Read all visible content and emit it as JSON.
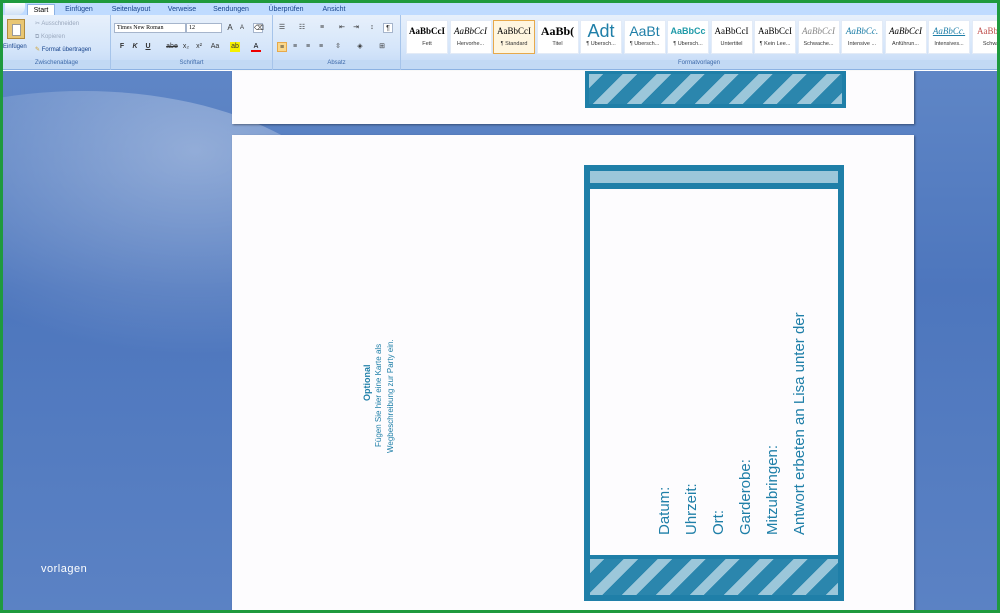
{
  "tabs": [
    "Start",
    "Einfügen",
    "Seitenlayout",
    "Verweise",
    "Sendungen",
    "Überprüfen",
    "Ansicht"
  ],
  "clipboard": {
    "paste": "Einfügen",
    "cut": "Ausschneiden",
    "copy": "Kopieren",
    "format_painter": "Format übertragen",
    "label": "Zwischenablage"
  },
  "font": {
    "name": "Times New Roman",
    "size": "12",
    "label": "Schriftart",
    "grow": "A",
    "shrink": "A",
    "bold": "F",
    "italic": "K",
    "underline": "U",
    "strike": "abe",
    "sub": "x₂",
    "sup": "x²",
    "case": "Aa"
  },
  "paragraph": {
    "label": "Absatz",
    "pilcrow": "¶"
  },
  "styles": {
    "label": "Formatvorlagen",
    "items": [
      {
        "preview": "AaBbCcI",
        "name": "Fett"
      },
      {
        "preview": "AaBbCcI",
        "name": "Hervorhe..."
      },
      {
        "preview": "AaBbCcI",
        "name": "¶ Standard"
      },
      {
        "preview": "AaBb(",
        "name": "Titel"
      },
      {
        "preview": "Adt",
        "name": "¶ Übersch..."
      },
      {
        "preview": "AaBt",
        "name": "¶ Übersch..."
      },
      {
        "preview": "AaBbCc",
        "name": "¶ Übersch..."
      },
      {
        "preview": "AaBbCcI",
        "name": "Untertitel"
      },
      {
        "preview": "AaBbCcI",
        "name": "¶ Kein Lee..."
      },
      {
        "preview": "AaBbCcI",
        "name": "Schwache..."
      },
      {
        "preview": "AaBbCc.",
        "name": "Intensive ..."
      },
      {
        "preview": "AaBbCcI",
        "name": "Anführun..."
      },
      {
        "preview": "AaBbCc.",
        "name": "Intensives..."
      },
      {
        "preview": "AaBbCc",
        "name": "Schwac"
      }
    ]
  },
  "doc": {
    "optional_title": "Optional",
    "optional_line1": "Fügen Sie hier eine Karte als",
    "optional_line2": "Wegbeschreibung zur Party ein.",
    "card_lines": [
      "Datum:",
      "Uhrzeit:",
      "Ort:",
      "Garderobe:",
      "Mitzubringen:",
      "Antwort erbeten an Lisa unter der"
    ]
  },
  "watermark": "vorlagen",
  "colors": {
    "accent": "#1f7fa8",
    "stripe_light": "#9cc7da",
    "background": "#4d76bd",
    "frame": "#1f9a3e"
  }
}
